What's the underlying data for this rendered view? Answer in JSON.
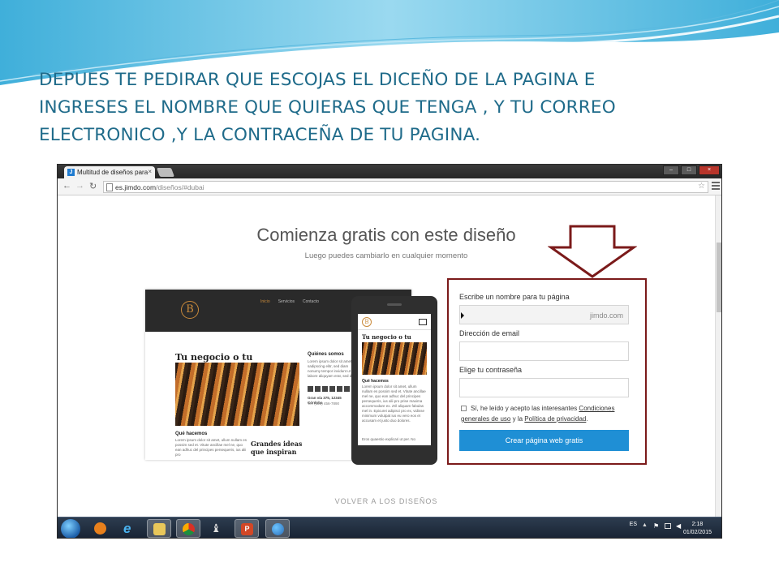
{
  "slide": {
    "title_lines": [
      "DEPUES TE PEDIRAR QUE ESCOJAS  EL DICEÑO DE LA PAGINA E",
      "INGRESES EL NOMBRE QUE QUIERAS QUE TENGA , Y TU CORREO",
      "ELECTRONICO ,Y  LA CONTRACEÑA DE TU PAGINA."
    ]
  },
  "browser": {
    "tab_title": "Multitud de diseños para",
    "tab_favicon": "J",
    "tab_close": "×",
    "url_host": "es.jimdo.com",
    "url_path": "/diseños/#dubai",
    "icons": [
      "back-arrow-icon",
      "forward-arrow-icon",
      "reload-icon",
      "page-icon",
      "star-icon",
      "menu-icon"
    ]
  },
  "page": {
    "title": "Comienza gratis con este diseño",
    "subtitle": "Luego puedes cambiarlo en cualquier momento",
    "back_link": "VOLVER A LOS DISEÑOS"
  },
  "desktop_preview": {
    "logo": "B",
    "nav": [
      "Inicio",
      "Servicios",
      "Contacto"
    ],
    "heading": "Tu negocio o tu proyecto",
    "section_heading": "Qué hacemos",
    "lorem": "Lorem ipsum dolor sit amet, ullum nullam es possim sed et. Vitute ancillae mel ne, quo ean adhuc del principes persequeris, ius alii pro",
    "side_heading": "Quiénes somos",
    "side_lorem": "Lorem ipsum dolor sit amet, sadipscing elitr, sed diam nonumy tempor invidunt ut labore aliquyam erat, sed diam.",
    "address": "Gran vía 375, 12345 Córdoba",
    "phone": "Tel. (123) 456-7890",
    "bottom_heading": "Grandes ideas que inspiran"
  },
  "mobile_preview": {
    "logo": "B",
    "heading": "Tu negocio o tu proyecto",
    "section_heading": "Qué hacemos",
    "lorem": "Lorem ipsum dolor sit amet, ullum nullam es possim sed et. Vitute ancillae mel ne, quo ean adhuc del principes persequeris, ius alii pro prise maxima accommodare ex. Zril aliquam fabulas mel in. Epicurei adipisci pro ex, vidisse minimum volutpat ius eu vero eos et accusam et justo duo dolores.",
    "lorem2": "Eros quaestio explicari ut per. No"
  },
  "form": {
    "name_label": "Escribe un nombre para tu página",
    "name_value": "",
    "name_suffix": "jimdo.com",
    "email_label": "Dirección de email",
    "email_value": "",
    "password_label": "Elige tu contraseña",
    "password_value": "",
    "terms_prefix": "Sí, he leído y acepto las interesantes ",
    "terms_link1": "Condiciones generales de uso",
    "terms_mid": " y la ",
    "terms_link2": "Política de privacidad",
    "terms_suffix": ".",
    "submit_label": "Crear página web gratis"
  },
  "taskbar": {
    "apps": [
      "windows-media-player-icon",
      "internet-explorer-icon",
      "file-explorer-icon",
      "chrome-icon",
      "chess-icon",
      "powerpoint-icon",
      "paint-icon"
    ],
    "language": "ES",
    "time": "2:18",
    "date": "01/02/2015"
  },
  "colors": {
    "title": "#1f6b8a",
    "form_border": "#7b1a1a",
    "button": "#1f8fd5",
    "arrow": "#7b1a1a"
  }
}
